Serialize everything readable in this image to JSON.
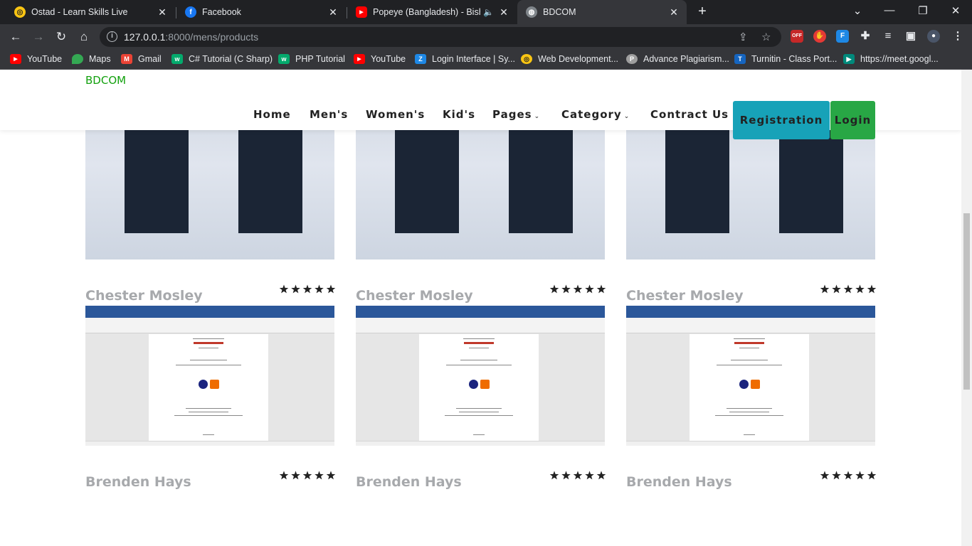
{
  "browser": {
    "tabs": [
      {
        "title": "Ostad - Learn Skills Live",
        "icon": "ostad-icon",
        "active": false
      },
      {
        "title": "Facebook",
        "icon": "facebook-icon",
        "active": false
      },
      {
        "title": "Popeye (Bangladesh) - Bisho",
        "icon": "youtube-icon",
        "active": false,
        "audio": true
      },
      {
        "title": "BDCOM",
        "icon": "globe-icon",
        "active": true
      }
    ],
    "url_host": "127.0.0.1",
    "url_path": ":8000/mens/products",
    "bookmarks": [
      {
        "label": "YouTube",
        "icon": "youtube-icon",
        "color": "#ff0000"
      },
      {
        "label": "Maps",
        "icon": "maps-icon",
        "color": "#34a853"
      },
      {
        "label": "Gmail",
        "icon": "gmail-icon",
        "color": "#ea4335"
      },
      {
        "label": "C# Tutorial (C Sharp)",
        "icon": "w3schools-icon",
        "color": "#04aa6d"
      },
      {
        "label": "PHP Tutorial",
        "icon": "w3schools-icon",
        "color": "#04aa6d"
      },
      {
        "label": "YouTube",
        "icon": "youtube-icon",
        "color": "#ff0000"
      },
      {
        "label": "Login Interface | Sy...",
        "icon": "zap-icon",
        "color": "#1e88e5"
      },
      {
        "label": "Web Development...",
        "icon": "ostad-icon",
        "color": "#f9c513"
      },
      {
        "label": "Advance Plagiarism...",
        "icon": "plagiarism-icon",
        "color": "#9e9e9e"
      },
      {
        "label": "Turnitin - Class Port...",
        "icon": "turnitin-icon",
        "color": "#1565c0"
      },
      {
        "label": "https://meet.googl...",
        "icon": "meet-icon",
        "color": "#00897b"
      }
    ]
  },
  "site": {
    "brand": "BDCOM",
    "nav": {
      "home": "Home",
      "mens": "Men's",
      "womens": "Women's",
      "kids": "Kid's",
      "pages": "Pages",
      "category": "Category",
      "contact": "Contract Us"
    },
    "registration": "Registration",
    "login": "Login",
    "colors": {
      "brand": "#13a10e",
      "registration": "#17a2b8",
      "login": "#28a745"
    }
  },
  "products": {
    "row1": [
      {
        "name": "Chester Mosley",
        "rating": 5,
        "image": "tshirt-photo"
      },
      {
        "name": "Chester Mosley",
        "rating": 5,
        "image": "tshirt-photo"
      },
      {
        "name": "Chester Mosley",
        "rating": 5,
        "image": "tshirt-photo"
      }
    ],
    "row2": [
      {
        "name": "Brenden Hays",
        "rating": 5,
        "image": "word-document-screenshot"
      },
      {
        "name": "Brenden Hays",
        "rating": 5,
        "image": "word-document-screenshot"
      },
      {
        "name": "Brenden Hays",
        "rating": 5,
        "image": "word-document-screenshot"
      }
    ]
  }
}
